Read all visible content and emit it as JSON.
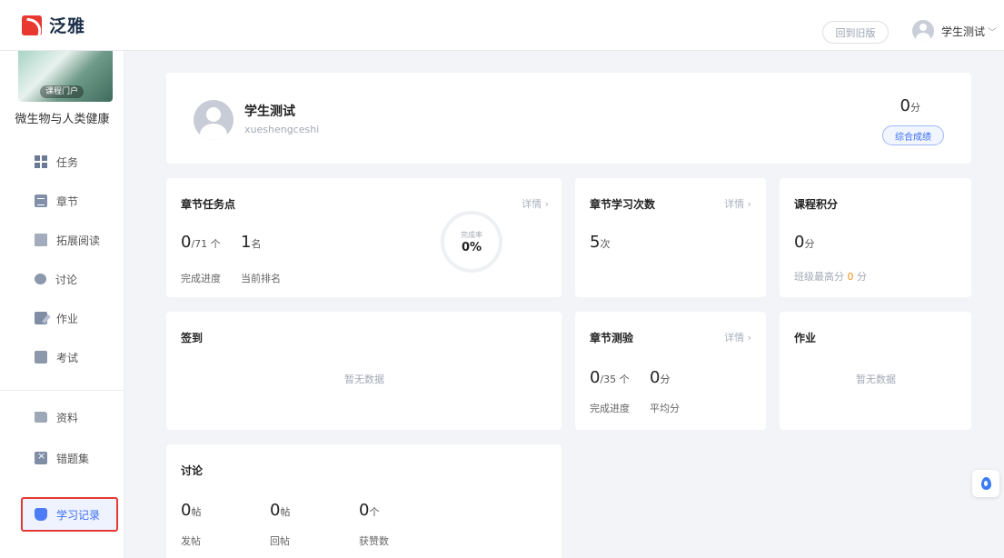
{
  "header": {
    "brand": "泛雅",
    "old_version_button": "回到旧版",
    "user_name": "学生测试",
    "user_menu_chevron": "﹀"
  },
  "sidebar": {
    "course_cover_ribbon": "课程门户",
    "course_name": "微生物与人类健康",
    "items": [
      {
        "label": "任务",
        "icon": "grid-icon"
      },
      {
        "label": "章节",
        "icon": "chapter-icon"
      },
      {
        "label": "拓展阅读",
        "icon": "book-icon"
      },
      {
        "label": "讨论",
        "icon": "chat-icon"
      },
      {
        "label": "作业",
        "icon": "edit-icon"
      },
      {
        "label": "考试",
        "icon": "exam-icon"
      },
      {
        "label": "资料",
        "icon": "folder-icon"
      },
      {
        "label": "错题集",
        "icon": "wrong-book-icon"
      },
      {
        "label": "学习记录",
        "icon": "record-icon",
        "active": true
      }
    ],
    "accent_color": "#3a6df0",
    "highlight_border_color": "#e53935"
  },
  "profile": {
    "name": "学生测试",
    "account": "xueshengceshi",
    "total_score": "0",
    "total_score_unit": "分",
    "score_button": "综合成绩"
  },
  "chapter_tasks": {
    "title": "章节任务点",
    "detail": "详情",
    "completed": "0",
    "total": "/71 个",
    "rank": "1",
    "rank_unit": "名",
    "progress_label": "完成进度",
    "rank_label": "当前排名",
    "ring_label": "完成率",
    "ring_value": "0%",
    "completion_rate": 0
  },
  "study_count": {
    "title": "章节学习次数",
    "detail": "详情",
    "value": "5",
    "unit": "次"
  },
  "course_points": {
    "title": "课程积分",
    "value": "0",
    "unit": "分",
    "class_max_label": "班级最高分",
    "class_max_value": "0",
    "class_max_unit": "分",
    "highlight_color": "#f08c1a"
  },
  "checkin": {
    "title": "签到",
    "empty": "暂无数据"
  },
  "chapter_quiz": {
    "title": "章节测验",
    "detail": "详情",
    "completed": "0",
    "total": "/35 个",
    "avg": "0",
    "avg_unit": "分",
    "progress_label": "完成进度",
    "avg_label": "平均分"
  },
  "homework": {
    "title": "作业",
    "empty": "暂无数据"
  },
  "discussion": {
    "title": "讨论",
    "posts": "0",
    "posts_unit": "帖",
    "posts_label": "发帖",
    "replies": "0",
    "replies_unit": "帖",
    "replies_label": "回帖",
    "likes": "0",
    "likes_unit": "个",
    "likes_label": "获赞数"
  }
}
